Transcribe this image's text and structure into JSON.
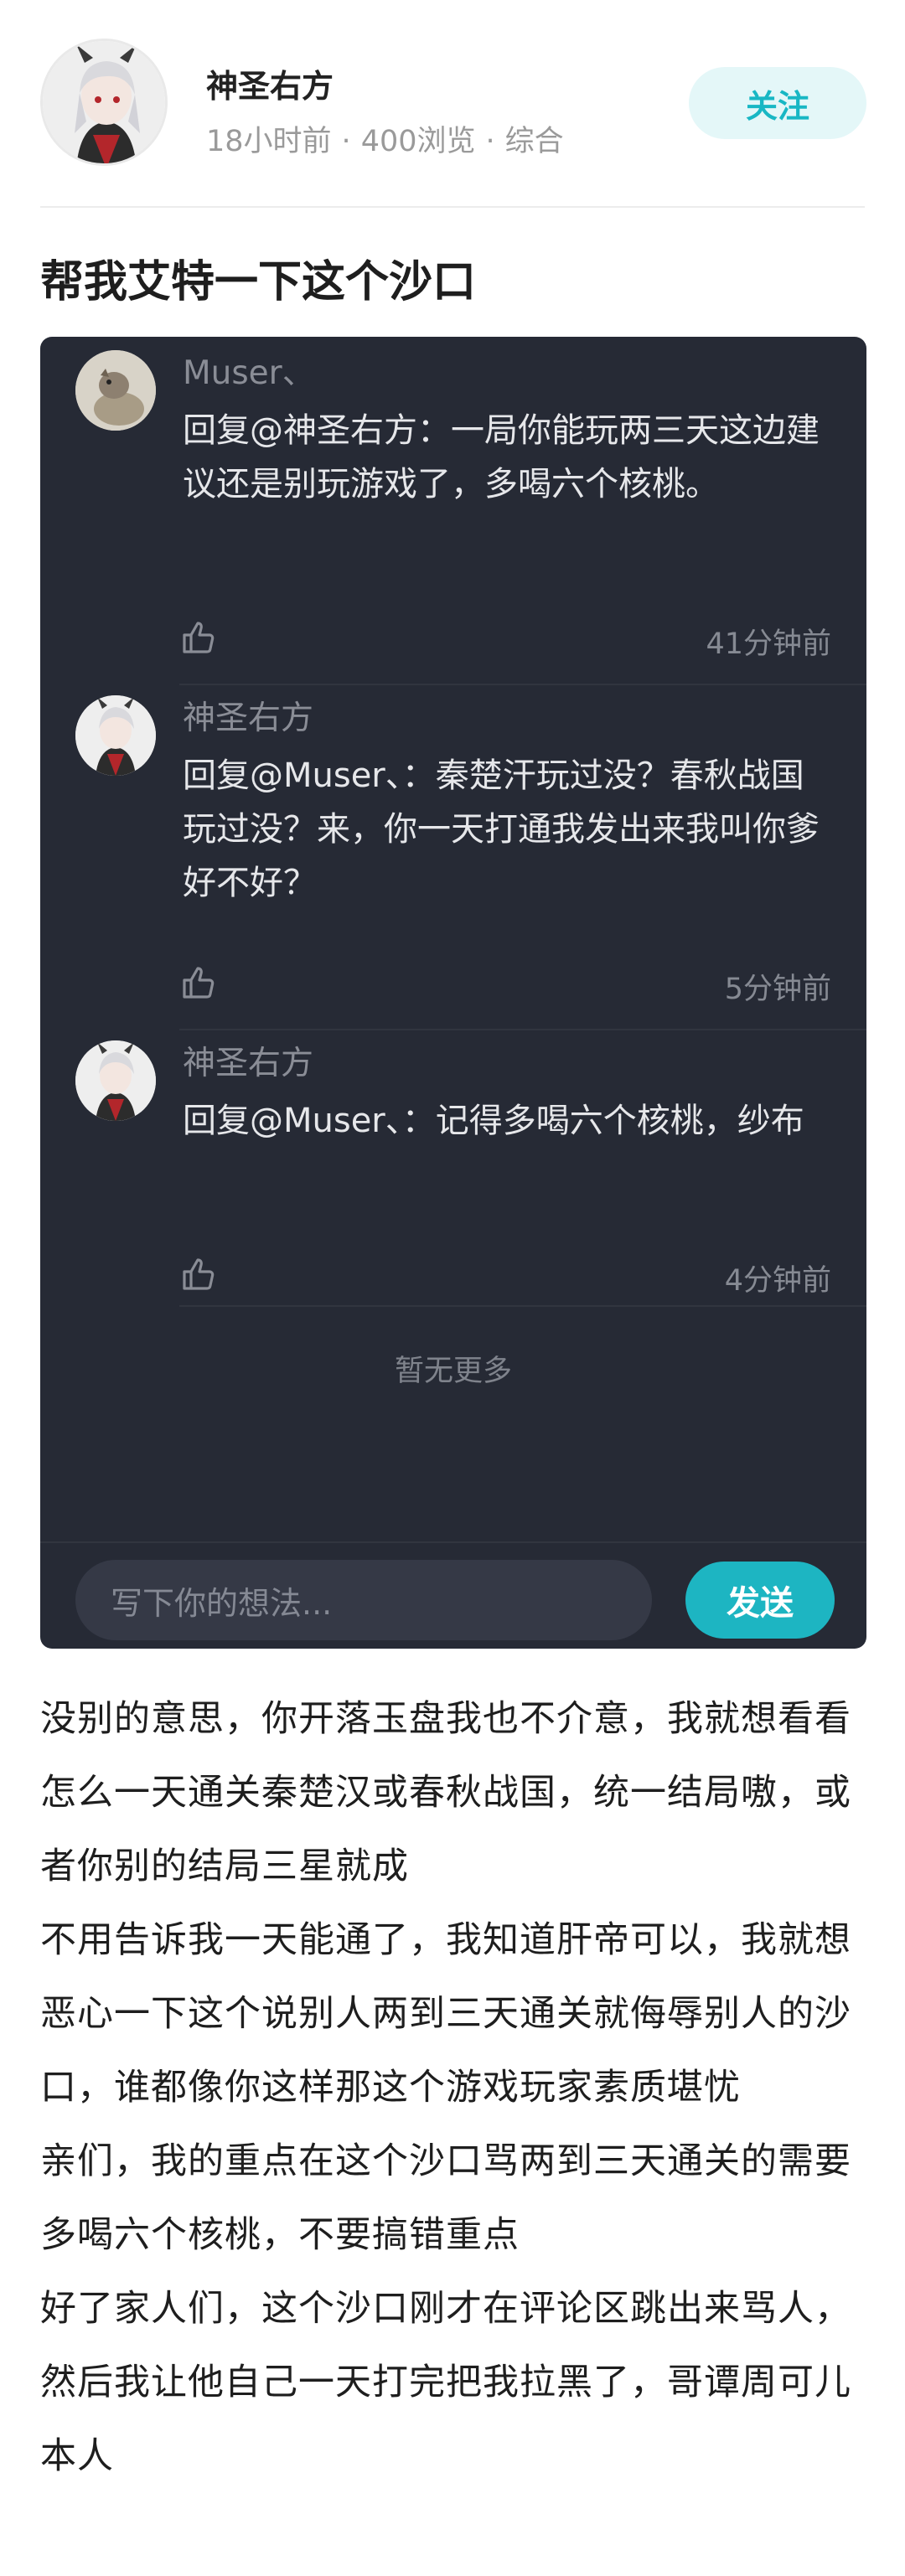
{
  "author": {
    "name": "神圣右方",
    "time": "18小时前",
    "views": "400浏览",
    "category": "综合",
    "separator": "·",
    "follow_label": "关注"
  },
  "post": {
    "title": "帮我艾特一下这个沙口",
    "paragraphs": [
      "没别的意思，你开落玉盘我也不介意，我就想看看怎么一天通关秦楚汉或春秋战国，统一结局嗷，或者你别的结局三星就成",
      "不用告诉我一天能通了，我知道肝帝可以，我就想恶心一下这个说别人两到三天通关就侮辱别人的沙口，谁都像你这样那这个游戏玩家素质堪忧",
      "亲们，我的重点在这个沙口骂两到三天通关的需要多喝六个核桃，不要搞错重点",
      "好了家人们，这个沙口刚才在评论区跳出来骂人，然后我让他自己一天打完把我拉黑了，哥谭周可儿本人"
    ]
  },
  "comments": [
    {
      "name": "Muser、",
      "text": "回复@神圣右方：一局你能玩两三天这边建议还是别玩游戏了，多喝六个核桃。",
      "time": "41分钟前",
      "like_icon": "thumbs-up-icon"
    },
    {
      "name": "神圣右方",
      "text": "回复@Muser、：秦楚汗玩过没？春秋战国玩过没？来，你一天打通我发出来我叫你爹好不好？",
      "time": "5分钟前",
      "like_icon": "thumbs-up-icon"
    },
    {
      "name": "神圣右方",
      "text": "回复@Muser、：记得多喝六个核桃，纱布",
      "time": "4分钟前",
      "like_icon": "thumbs-up-icon"
    }
  ],
  "no_more_label": "暂无更多",
  "comment_input": {
    "placeholder": "写下你的想法...",
    "send_label": "发送"
  },
  "colors": {
    "accent": "#1db5c2",
    "panel_bg": "#262a35",
    "follow_bg": "#e4f7f8"
  }
}
